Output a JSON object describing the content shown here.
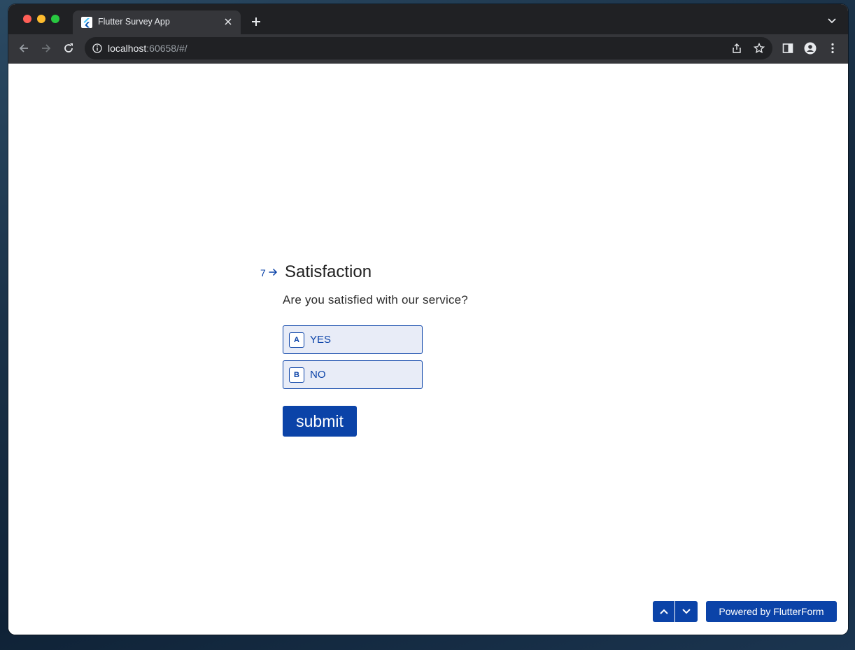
{
  "browser": {
    "tab": {
      "title": "Flutter Survey App"
    },
    "url": {
      "host": "localhost",
      "rest": ":60658/#/"
    }
  },
  "question": {
    "number": "7",
    "title": "Satisfaction",
    "description": "Are you satisfied with our service?",
    "options": [
      {
        "key": "A",
        "label": "YES"
      },
      {
        "key": "B",
        "label": "NO"
      }
    ],
    "submit_label": "submit"
  },
  "footer": {
    "powered_label": "Powered by FlutterForm"
  },
  "colors": {
    "accent": "#0b43a8",
    "option_bg": "#e8ecf7",
    "chrome_dark": "#202124",
    "chrome_toolbar": "#35363a"
  },
  "icons": [
    "flutter-icon",
    "close-icon",
    "plus-icon",
    "chevron-down-icon",
    "back-icon",
    "forward-icon",
    "reload-icon",
    "info-icon",
    "share-icon",
    "star-icon",
    "side-panel-icon",
    "profile-icon",
    "more-icon",
    "arrow-right-icon",
    "chevron-up-icon"
  ]
}
